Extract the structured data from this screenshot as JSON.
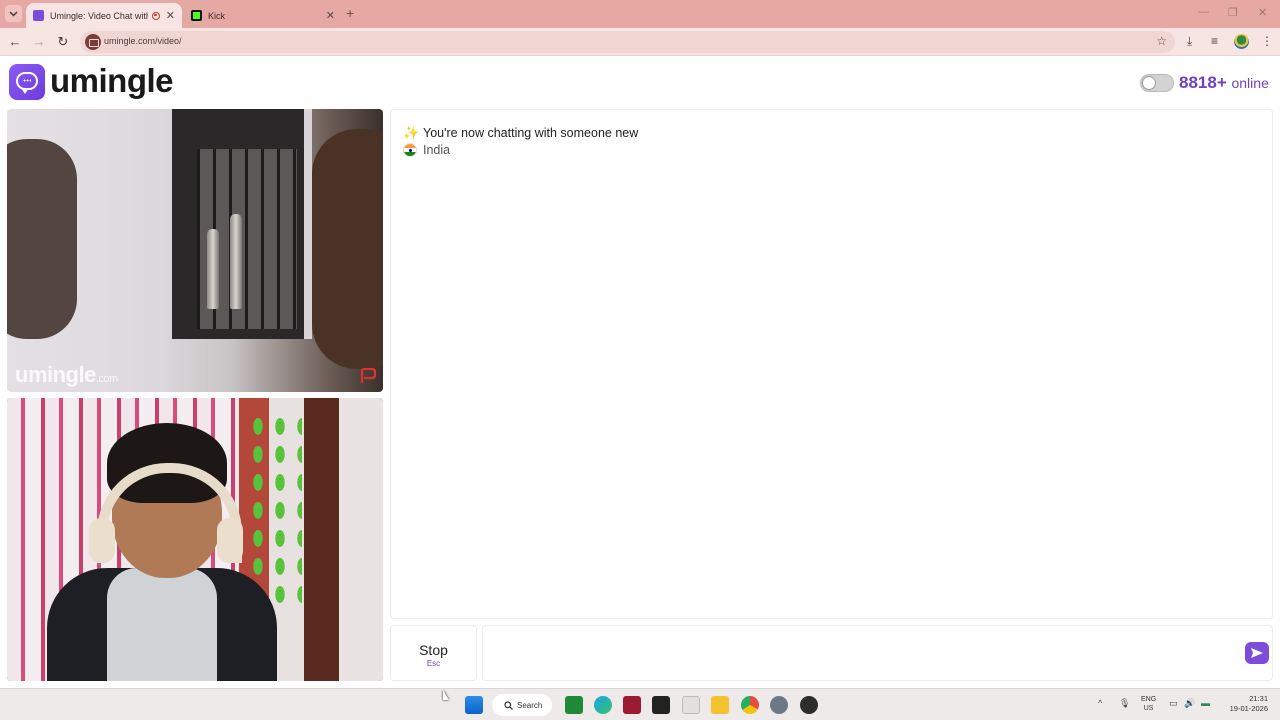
{
  "browser": {
    "tabs": [
      {
        "title": "Umingle: Video Chat with S",
        "active": true
      },
      {
        "title": "Kick",
        "active": false
      }
    ],
    "url": "umingle.com/video/"
  },
  "header": {
    "logo_text": "umingle",
    "online_count": "8818+",
    "online_suffix": "online"
  },
  "videos": {
    "watermark": "umingle",
    "watermark_suffix": ".com"
  },
  "chat": {
    "messages": [
      {
        "icon": "sparkle-icon",
        "text": "You're now chatting with someone new"
      },
      {
        "icon": "india-flag-icon",
        "text": "India"
      }
    ],
    "stop_label": "Stop",
    "stop_shortcut": "Esc",
    "input_value": "",
    "input_placeholder": ""
  },
  "taskbar": {
    "search_label": "Search",
    "lang_line1": "ENG",
    "lang_line2": "US",
    "time": "21:31",
    "date": "19-01-2026"
  },
  "colors": {
    "brand": "#7c4ddb",
    "tabstrip": "#e6a8a2",
    "toolbar": "#f7e5e3"
  }
}
